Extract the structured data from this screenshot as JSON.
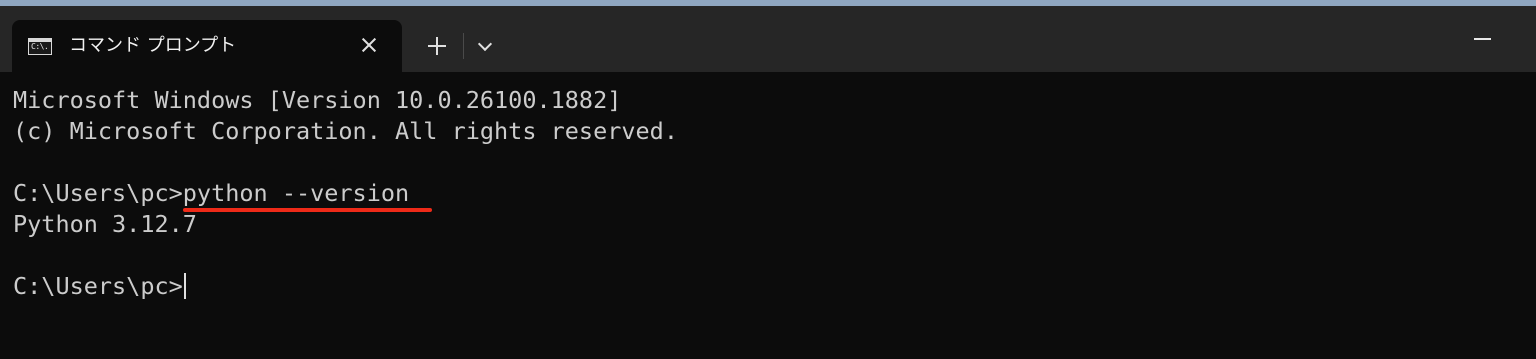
{
  "window": {
    "tab": {
      "title": "コマンド プロンプト",
      "icon": "cmd-icon",
      "icon_glyph": "C:\\.",
      "close_icon": "close-icon"
    },
    "new_tab_icon": "plus-icon",
    "dropdown_icon": "chevron-down-icon",
    "minimize_icon": "minimize-icon"
  },
  "terminal": {
    "lines": [
      "Microsoft Windows [Version 10.0.26100.1882]",
      "(c) Microsoft Corporation. All rights reserved.",
      "",
      "C:\\Users\\pc>python --version",
      "Python 3.12.7",
      "",
      "C:\\Users\\pc>"
    ],
    "annotation_color": "#ee2a18"
  },
  "colors": {
    "terminal_background": "#0c0c0c",
    "titlebar_background": "#262626",
    "text": "#cccccc"
  }
}
